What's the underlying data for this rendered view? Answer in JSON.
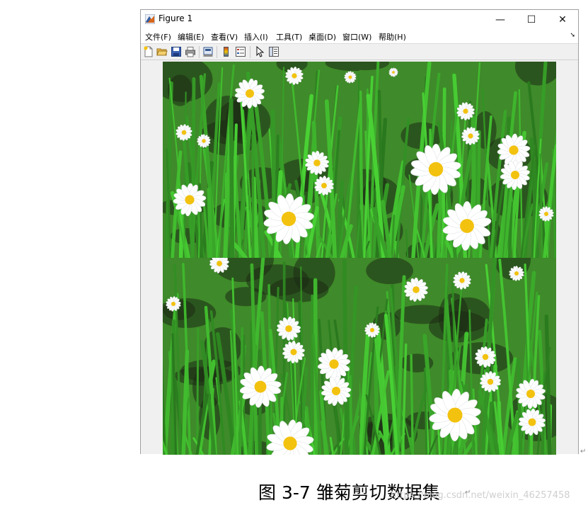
{
  "window": {
    "title": "Figure 1",
    "controls": {
      "minimize": "—",
      "maximize": "☐",
      "close": "✕"
    }
  },
  "menu": [
    {
      "label": "文件(F)"
    },
    {
      "label": "编辑(E)"
    },
    {
      "label": "查看(V)"
    },
    {
      "label": "插入(I)"
    },
    {
      "label": "工具(T)"
    },
    {
      "label": "桌面(D)"
    },
    {
      "label": "窗口(W)"
    },
    {
      "label": "帮助(H)"
    }
  ],
  "toolbar_icons": [
    "new-figure-icon",
    "open-file-icon",
    "save-icon",
    "print-icon",
    "print-preview-icon",
    "colorbar-icon",
    "legend-icon",
    "pointer-icon",
    "property-inspector-icon"
  ],
  "figure": {
    "tiles": [
      {
        "name": "tile-top-left"
      },
      {
        "name": "tile-top-right"
      },
      {
        "name": "tile-bottom-left"
      },
      {
        "name": "tile-bottom-right"
      }
    ]
  },
  "caption": "图 3-7 雏菊剪切数据集",
  "watermark": "https://blog.csdn.net/weixin_46257458",
  "colors": {
    "grass": "#3f8a2a",
    "petal": "#ffffff",
    "center": "#f2c20f",
    "soil": "#1c2a14"
  }
}
